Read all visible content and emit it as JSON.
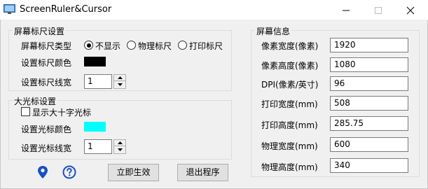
{
  "window": {
    "title": "ScreenRuler&Cursor",
    "icon": "monitor-icon",
    "controls": [
      "minimize-icon",
      "maximize-icon",
      "close-icon"
    ]
  },
  "ruler": {
    "group_title": "屏幕标尺设置",
    "type_label": "屏幕标尺类型",
    "options": [
      {
        "label": "不显示",
        "checked": true
      },
      {
        "label": "物理标尺",
        "checked": false
      },
      {
        "label": "打印标尺",
        "checked": false
      }
    ],
    "color_label": "设置标尺颜色",
    "color": "#000000",
    "width_label": "设置标尺线宽",
    "width_value": "1"
  },
  "cursor": {
    "group_title": "大光标设置",
    "crosshair_label": "显示大十字光标",
    "crosshair_checked": false,
    "color_label": "设置光标颜色",
    "color": "#00ffff",
    "width_label": "设置光标线宽",
    "width_value": "1"
  },
  "screen_info": {
    "group_title": "屏幕信息",
    "rows": [
      {
        "label": "像素宽度(像素)",
        "value": "1920"
      },
      {
        "label": "像素高度(像素)",
        "value": "1080"
      },
      {
        "label": "DPI(像素/英寸)",
        "value": "96"
      },
      {
        "label": "打印宽度(mm)",
        "value": "508"
      },
      {
        "label": "打印高度(mm)",
        "value": "285.75"
      },
      {
        "label": "物理宽度(mm)",
        "value": "600"
      },
      {
        "label": "物理高度(mm)",
        "value": "340"
      }
    ]
  },
  "footer": {
    "location_icon": "location-pin-icon",
    "help_icon": "help-icon",
    "apply_label": "立即生效",
    "exit_label": "退出程序"
  },
  "colors": {
    "icon_blue": "#1a4fc4",
    "window_bg": "#f0f0f0"
  }
}
